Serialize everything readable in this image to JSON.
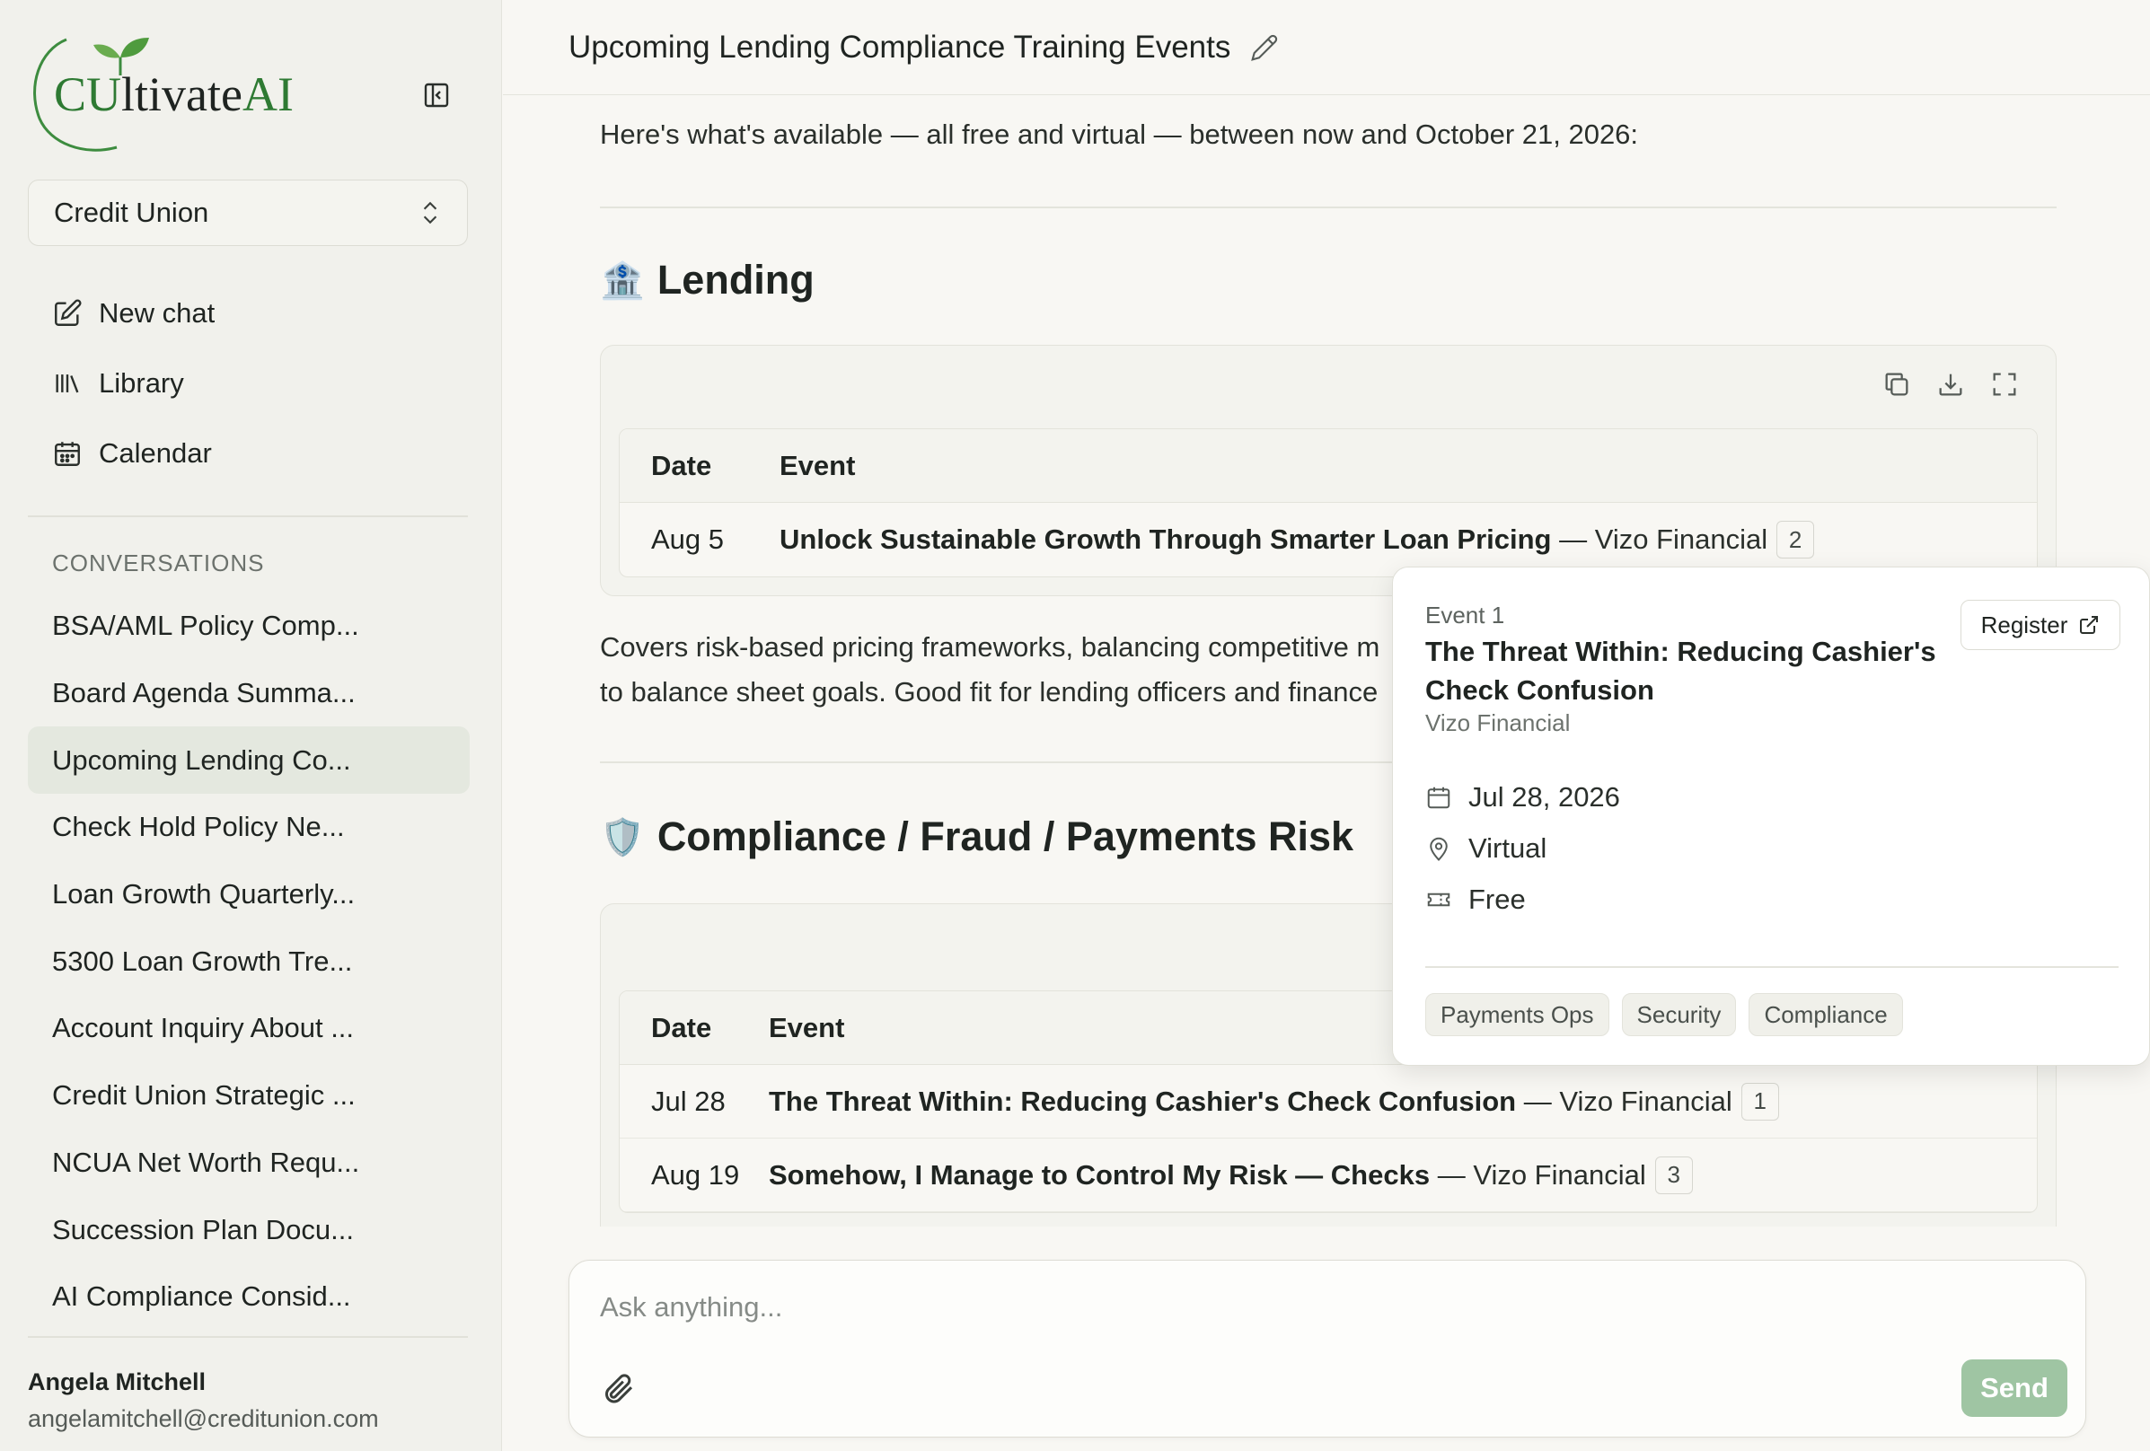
{
  "brand": {
    "logo_prefix": "CU",
    "logo_mid": "ltivate",
    "logo_suffix": "AI",
    "accent": "#2e7a33"
  },
  "sidebar": {
    "org_select": "Credit Union",
    "nav": [
      {
        "label": "New chat",
        "icon": "edit-icon"
      },
      {
        "label": "Library",
        "icon": "library-icon"
      },
      {
        "label": "Calendar",
        "icon": "calendar-icon"
      }
    ],
    "section_label": "CONVERSATIONS",
    "conversations": [
      "BSA/AML Policy Comp...",
      "Board Agenda Summa...",
      "Upcoming Lending Co...",
      "Check Hold Policy Ne...",
      "Loan Growth Quarterly...",
      "5300 Loan Growth Tre...",
      "Account Inquiry About ...",
      "Credit Union Strategic ...",
      "NCUA Net Worth Requ...",
      "Succession Plan Docu...",
      "AI Compliance Consid..."
    ],
    "active_index": 2,
    "user": {
      "name": "Angela Mitchell",
      "email": "angelamitchell@creditunion.com"
    }
  },
  "header": {
    "title": "Upcoming Lending Compliance Training Events"
  },
  "content": {
    "intro": "Here's what's available — all free and virtual — between now and October 21, 2026:",
    "sections": [
      {
        "emoji": "🏦",
        "title": "Lending",
        "columns": [
          "Date",
          "Event"
        ],
        "rows": [
          {
            "date": "Aug 5",
            "title": "Unlock Sustainable Growth Through Smarter Loan Pricing",
            "sep": " — ",
            "org": "Vizo Financial",
            "badge": "2"
          }
        ],
        "paragraph_lines": [
          "Covers risk-based pricing frameworks, balancing competitive m",
          "to balance sheet goals. Good fit for lending officers and finance"
        ]
      },
      {
        "emoji": "🛡️",
        "title": "Compliance / Fraud / Payments Risk",
        "columns": [
          "Date",
          "Event"
        ],
        "rows": [
          {
            "date": "Jul 28",
            "title": "The Threat Within: Reducing Cashier's Check Confusion",
            "sep": " — ",
            "org": "Vizo Financial",
            "badge": "1"
          },
          {
            "date": "Aug 19",
            "title": "Somehow, I Manage to Control My Risk — Checks",
            "sep": " — ",
            "org": "Vizo Financial",
            "badge": "3"
          }
        ]
      }
    ]
  },
  "composer": {
    "placeholder": "Ask anything...",
    "send_label": "Send"
  },
  "popover": {
    "kicker": "Event 1",
    "title": "The Threat Within: Reducing Cashier's Check Confusion",
    "org": "Vizo Financial",
    "register_label": "Register",
    "date": "Jul 28, 2026",
    "location": "Virtual",
    "price": "Free",
    "tags": [
      "Payments Ops",
      "Security",
      "Compliance"
    ]
  }
}
